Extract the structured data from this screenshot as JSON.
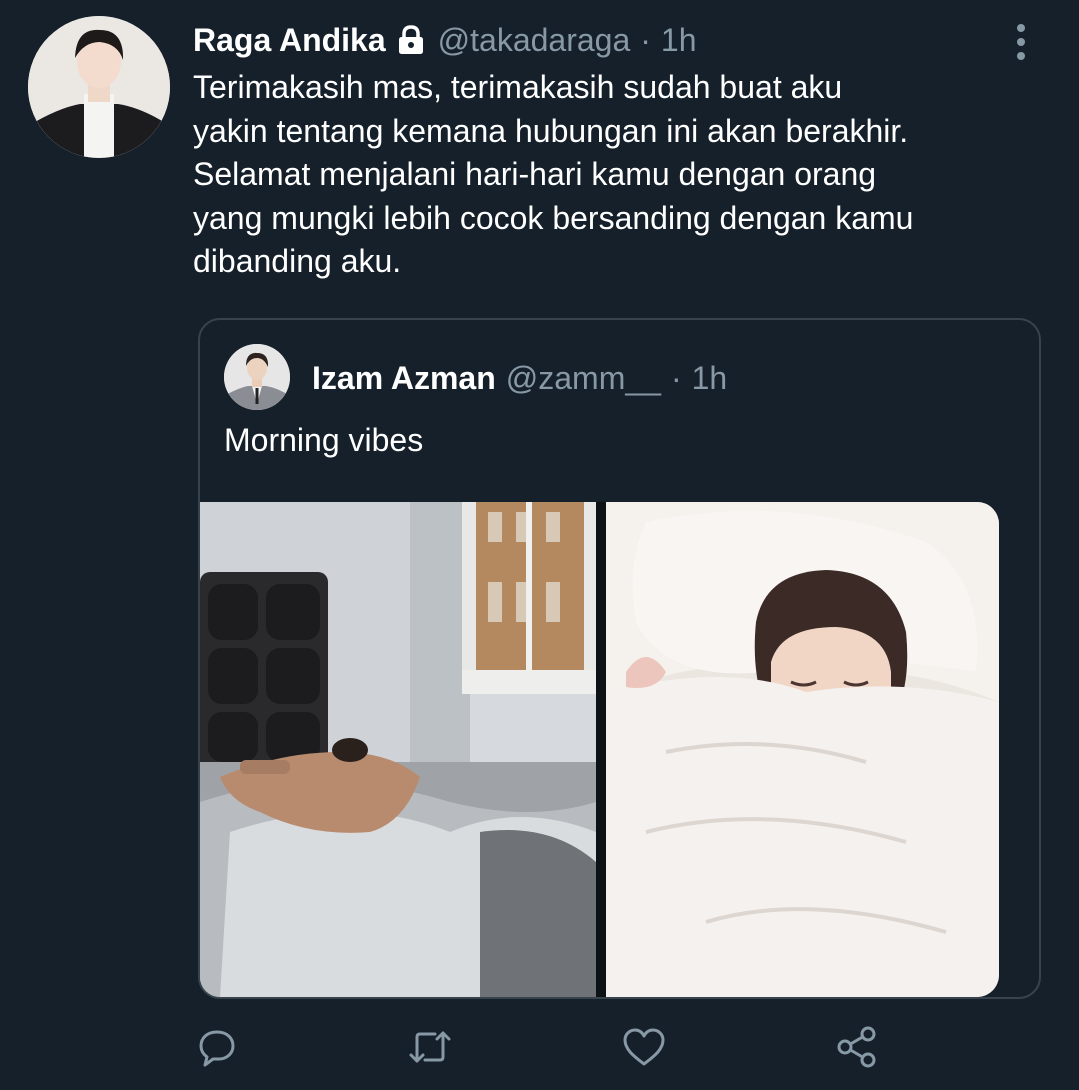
{
  "tweet": {
    "author_name": "Raga Andika",
    "author_handle": "@takadaraga",
    "separator": "·",
    "time": "1h",
    "text_lines": [
      "Terimakasih mas, terimakasih sudah buat aku",
      "yakin tentang kemana hubungan ini akan berakhir.",
      "Selamat menjalani hari-hari kamu dengan orang",
      "yang mungki lebih cocok bersanding dengan kamu",
      "dibanding aku."
    ]
  },
  "quoted_tweet": {
    "author_name": "Izam Azman",
    "author_handle": "@zamm__",
    "separator": "·",
    "time": "1h",
    "text": "Morning vibes"
  },
  "icons": {
    "lock": "lock-icon",
    "more": "more-vertical-icon",
    "reply": "reply-icon",
    "retweet": "retweet-icon",
    "like": "heart-icon",
    "share": "share-icon"
  },
  "colors": {
    "background": "#15202b",
    "secondary_text": "#8899a6",
    "border": "#38444d",
    "primary_text": "#ffffff"
  }
}
